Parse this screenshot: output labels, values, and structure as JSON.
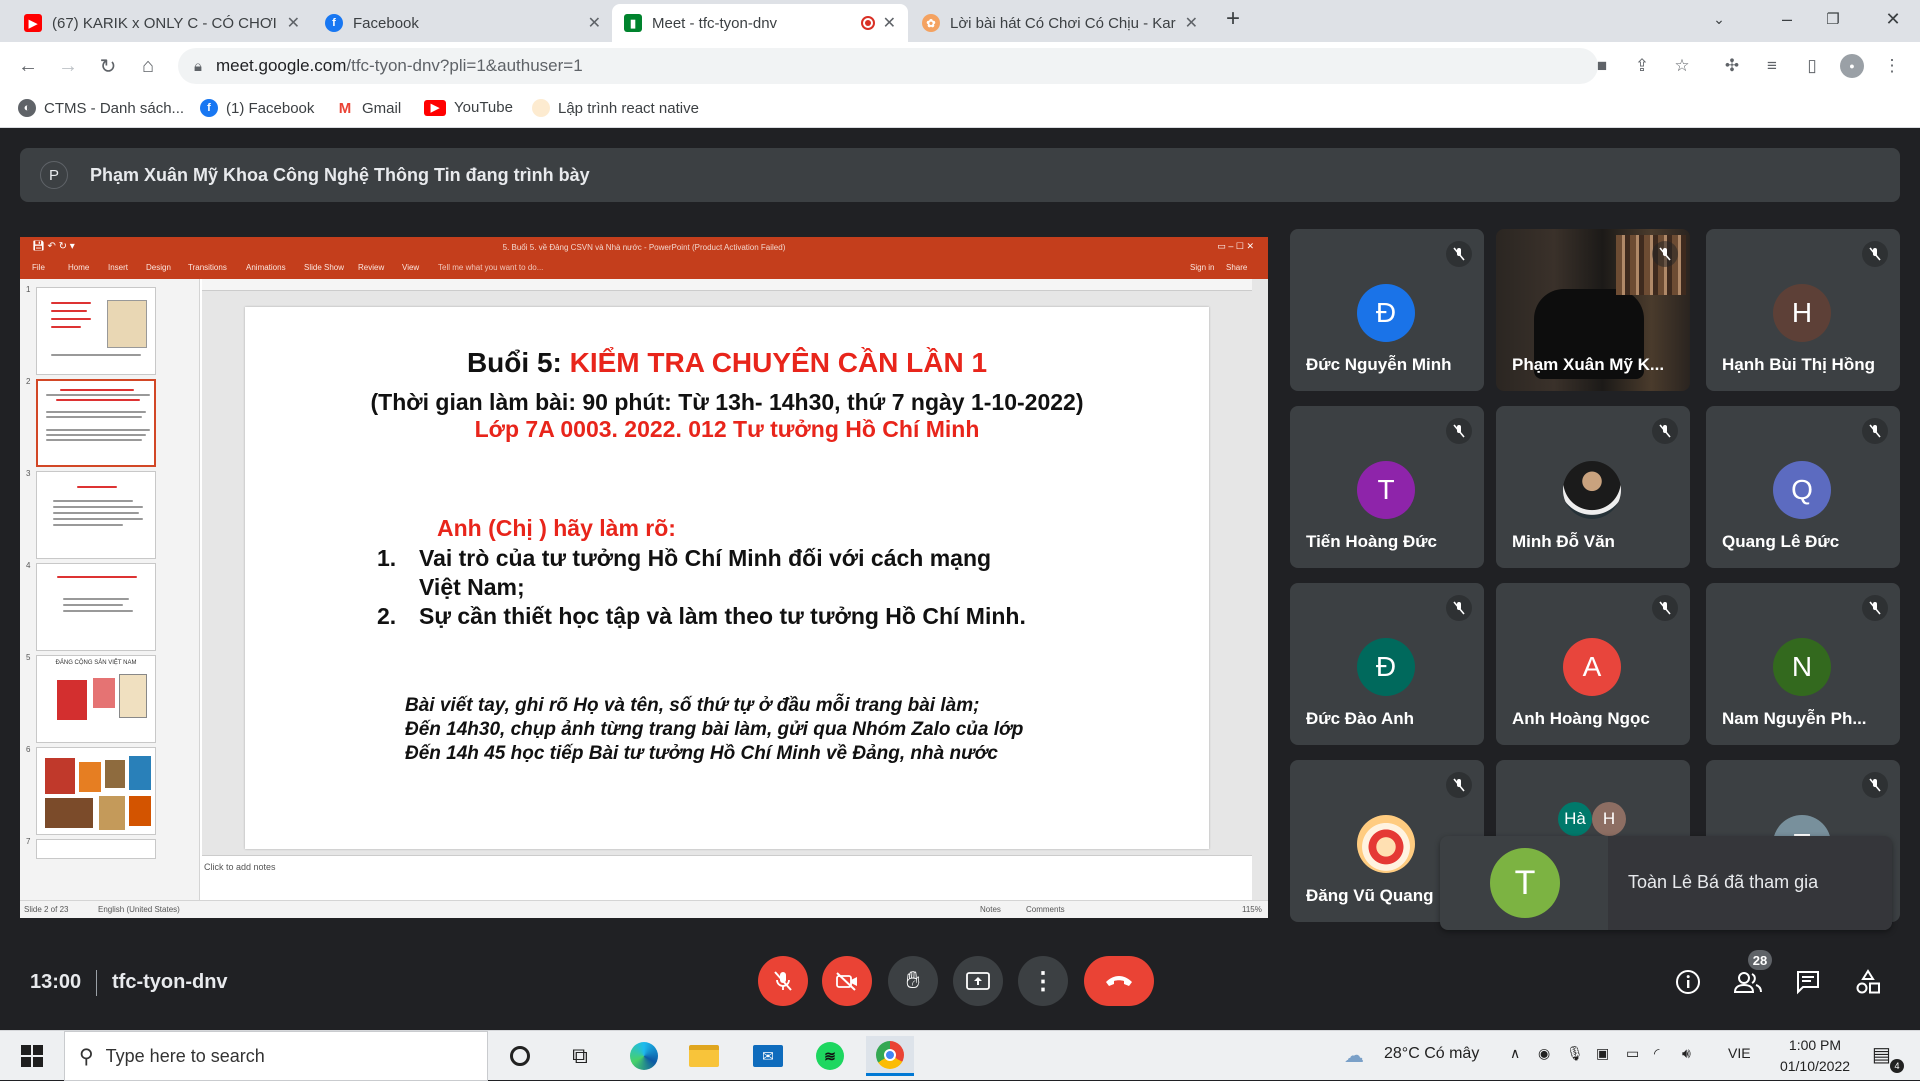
{
  "browser": {
    "tabs": [
      {
        "title": "(67) KARIK x ONLY C - CÓ CHƠI C",
        "icon": "youtube-icon"
      },
      {
        "title": "Facebook",
        "icon": "facebook-icon"
      },
      {
        "title": "Meet - tfc-tyon-dnv",
        "icon": "google-meet-icon",
        "active": true
      },
      {
        "title": "Lời bài hát Có Chơi Có Chịu - Kar",
        "icon": "lyrics-site-icon"
      }
    ],
    "url_host": "meet.google.com",
    "url_path": "/tfc-tyon-dnv?pli=1&authuser=1",
    "bookmarks": [
      {
        "label": "CTMS - Danh sách...",
        "icon": "ctms-icon"
      },
      {
        "label": "(1) Facebook",
        "icon": "facebook-icon"
      },
      {
        "label": "Gmail",
        "icon": "gmail-icon"
      },
      {
        "label": "YouTube",
        "icon": "youtube-icon"
      },
      {
        "label": "Lập trình react native",
        "icon": "page-icon"
      }
    ]
  },
  "meet": {
    "presenter_initial": "P",
    "presenter_banner": "Phạm Xuân Mỹ Khoa Công Nghệ Thông Tin đang trình bày",
    "time": "13:00",
    "meeting_code": "tfc-tyon-dnv",
    "participant_count": "28",
    "toast": {
      "initial": "T",
      "text": "Toàn Lê Bá đã tham gia",
      "color": "#7cb342"
    },
    "participants": [
      {
        "initial": "Đ",
        "name": "Đức Nguyễn Minh",
        "color": "#1a73e8"
      },
      {
        "initial": "",
        "name": "Phạm Xuân Mỹ K...",
        "color": "#1f1f1f",
        "video": true
      },
      {
        "initial": "H",
        "name": "Hạnh Bùi Thị Hồng",
        "color": "#5d4037"
      },
      {
        "initial": "T",
        "name": "Tiến Hoàng Đức",
        "color": "#8e24aa"
      },
      {
        "initial": "",
        "name": "Minh Đỗ Văn",
        "color": "#263238",
        "photo": true
      },
      {
        "initial": "Q",
        "name": "Quang Lê Đức",
        "color": "#5c6bc0"
      },
      {
        "initial": "Đ",
        "name": "Đức Đào Anh",
        "color": "#00695c"
      },
      {
        "initial": "A",
        "name": "Anh Hoàng Ngọc",
        "color": "#e8453c"
      },
      {
        "initial": "N",
        "name": "Nam Nguyễn Ph...",
        "color": "#33691e"
      },
      {
        "initial": "",
        "name": "Đăng Vũ Quang",
        "color": "#ffcc80",
        "photo": true
      },
      {
        "initial": "Hà",
        "name": "",
        "color": "#00796b",
        "second_initial": "H",
        "second_color": "#8d6e63"
      },
      {
        "initial": "T",
        "name": "",
        "color": "#78909c"
      }
    ]
  },
  "ppt": {
    "window_title": "5. Buổi 5. về Đảng CSVN và Nhà nước - PowerPoint (Product Activation Failed)",
    "ribbon_tabs": [
      "File",
      "Home",
      "Insert",
      "Design",
      "Transitions",
      "Animations",
      "Slide Show",
      "Review",
      "View"
    ],
    "tell_me": "Tell me what you want to do...",
    "sign_in": "Sign in",
    "share": "Share",
    "slide_numbers": [
      "1",
      "2",
      "3",
      "4",
      "5",
      "6",
      "7"
    ],
    "thumb5_title": "ĐẢNG CỘNG SẢN VIỆT NAM",
    "notes_placeholder": "Click to add notes",
    "status_slide": "Slide 2 of 23",
    "status_lang": "English (United States)",
    "status_notes": "Notes",
    "status_comments": "Comments",
    "status_zoom": "115%"
  },
  "slide": {
    "title_prefix": "Buổi 5: ",
    "title_red": "KIỂM TRA CHUYÊN CẦN LẦN 1",
    "time_line": "(Thời gian làm bài: 90 phút: Từ 13h- 14h30, thứ 7 ngày 1-10-2022)",
    "class_line": "Lớp 7A 0003. 2022. 012 Tư tưởng Hồ Chí Minh",
    "prompt": "Anh (Chị ) hãy làm rõ:",
    "items": [
      {
        "num": "1.",
        "line1": "Vai trò của tư tưởng Hồ Chí Minh đối với cách mạng",
        "line2": "Việt Nam;"
      },
      {
        "num": "2.",
        "line1": "Sự cần thiết học tập và làm theo tư tưởng Hồ Chí Minh.",
        "line2": ""
      }
    ],
    "notes": [
      "Bài viết tay, ghi rõ Họ và tên, số thứ tự ở đầu mỗi trang bài làm;",
      "Đến 14h30, chụp ảnh từng trang bài làm, gửi qua Nhóm Zalo của lớp",
      "Đến 14h 45 học tiếp Bài tư tưởng Hồ Chí Minh về Đảng, nhà nước"
    ]
  },
  "taskbar": {
    "search_placeholder": "Type here to search",
    "weather": "28°C  Có mây",
    "lang": "VIE",
    "time": "1:00 PM",
    "date": "01/10/2022",
    "notif_count": "4"
  }
}
